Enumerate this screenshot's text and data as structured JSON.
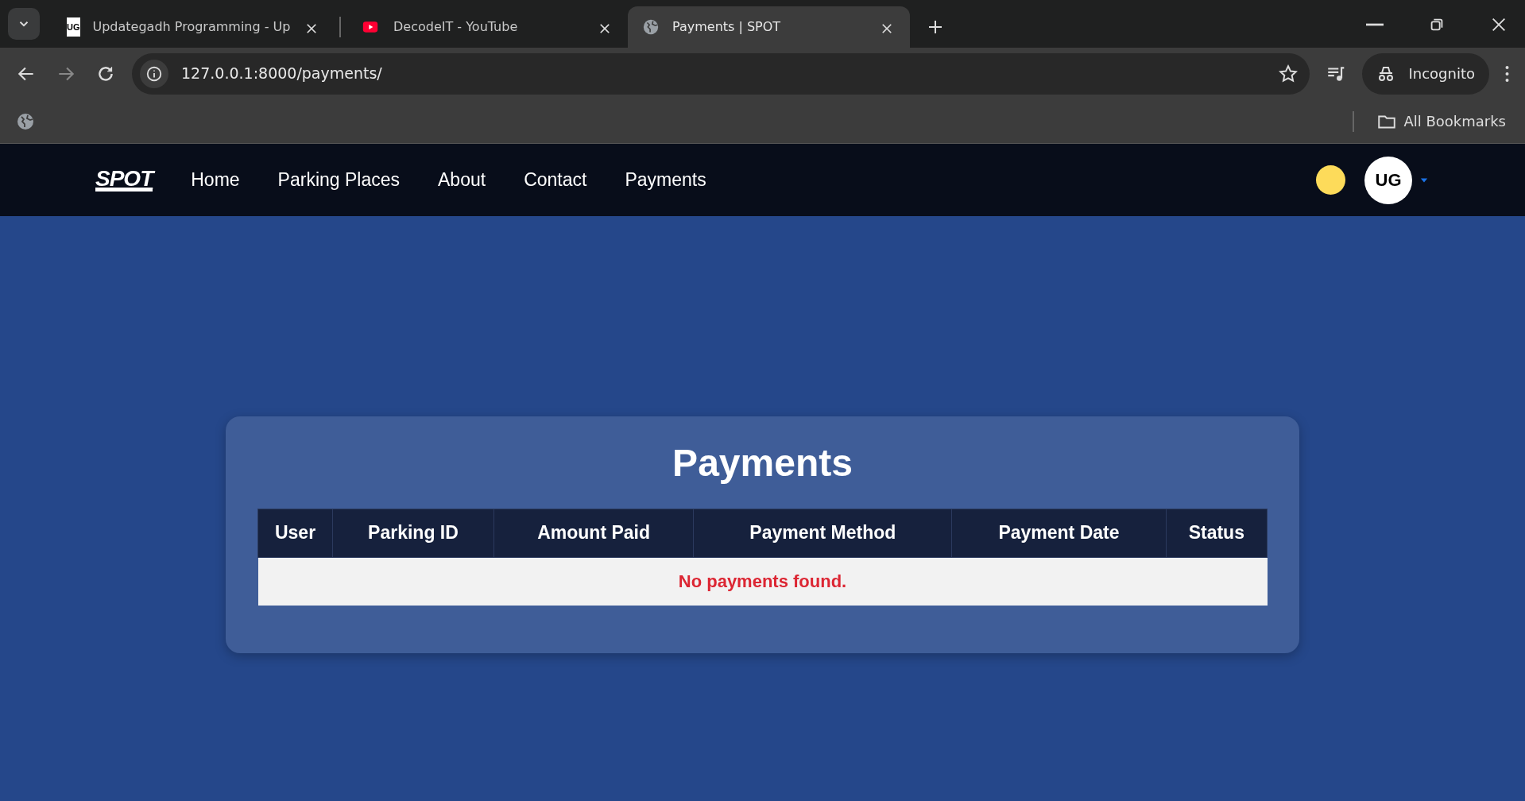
{
  "browser": {
    "tabs": [
      {
        "title": "Updategadh Programming - Up",
        "kind": "logo",
        "logo_text": "UG",
        "selected": false
      },
      {
        "title": "DecodeIT - YouTube",
        "kind": "video",
        "selected": false
      },
      {
        "title": "Payments | SPOT",
        "kind": "globe",
        "selected": true
      }
    ],
    "address": "127.0.0.1:8000/payments/",
    "profile": "Incognito",
    "bookmarks_label": "All Bookmarks"
  },
  "navbar": {
    "brand": "SPOT",
    "links": [
      {
        "label": "Home",
        "selected": false
      },
      {
        "label": "Parking Places",
        "selected": false
      },
      {
        "label": "About",
        "selected": false
      },
      {
        "label": "Contact",
        "selected": false
      },
      {
        "label": "Payments",
        "selected": false
      }
    ],
    "avatar_text": "UG"
  },
  "page": {
    "title": "Payments",
    "table": {
      "columns": [
        "User",
        "Parking ID",
        "Amount Paid",
        "Payment Method",
        "Payment Date",
        "Status"
      ],
      "empty_message": "No payments found."
    }
  }
}
